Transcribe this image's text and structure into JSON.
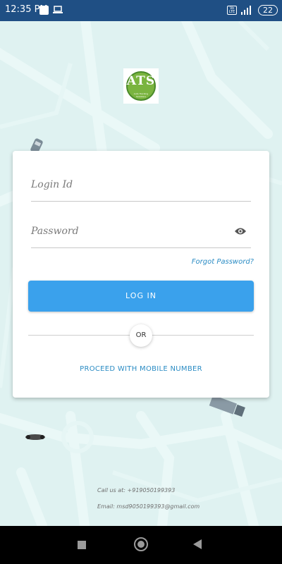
{
  "status_bar": {
    "time": "12:35 PM",
    "volte": "Vo LTE",
    "battery": "22",
    "icons": [
      "upload-icon",
      "laptop-icon",
      "signal-icon"
    ]
  },
  "logo": {
    "text": "ATS",
    "subtext": "Auto Tracking Solutions"
  },
  "login_form": {
    "login_id_placeholder": "Login Id",
    "password_placeholder": "Password",
    "forgot_password": "Forgot Password?",
    "login_button": "LOG IN",
    "or_label": "OR",
    "mobile_link": "PROCEED WITH MOBILE NUMBER"
  },
  "contact": {
    "call": "Call us at:  +919050199393",
    "email": "Email:  msd9050199393@gmail.com"
  },
  "colors": {
    "status_bar": "#1f4f84",
    "accent": "#3aa1ec",
    "link": "#2b8cc4",
    "map_bg": "#dff2f1",
    "logo_green": "#7ab43f"
  }
}
